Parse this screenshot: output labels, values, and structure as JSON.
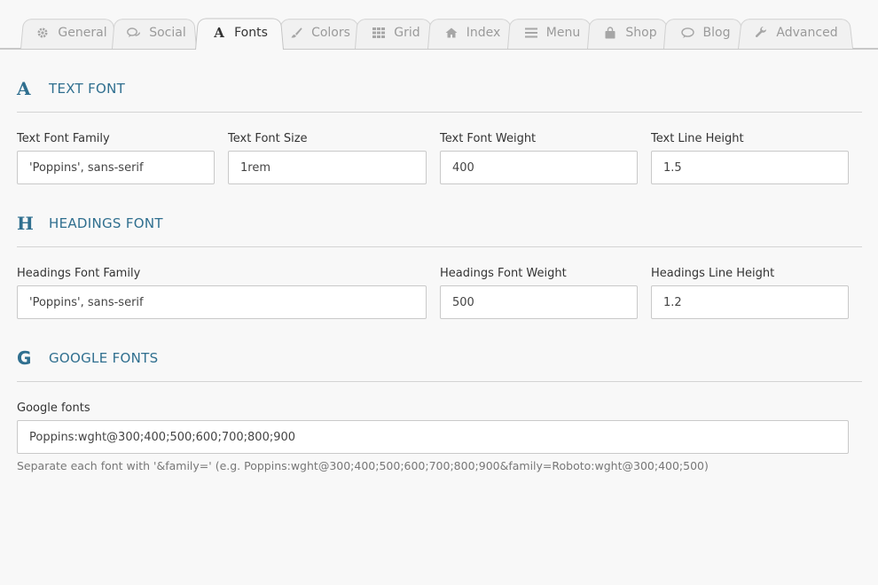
{
  "tabs": [
    {
      "label": "General",
      "icon": "gear-icon"
    },
    {
      "label": "Social",
      "icon": "comments-icon"
    },
    {
      "label": "Fonts",
      "icon": "font-icon",
      "active": true
    },
    {
      "label": "Colors",
      "icon": "brush-icon"
    },
    {
      "label": "Grid",
      "icon": "grid-icon"
    },
    {
      "label": "Index",
      "icon": "home-icon"
    },
    {
      "label": "Menu",
      "icon": "bars-icon"
    },
    {
      "label": "Shop",
      "icon": "shopping-bag-icon"
    },
    {
      "label": "Blog",
      "icon": "comment-icon"
    },
    {
      "label": "Advanced",
      "icon": "wrench-icon"
    }
  ],
  "text_font": {
    "letter": "A",
    "title": "TEXT FONT",
    "family_label": "Text Font Family",
    "family_value": "'Poppins', sans-serif",
    "size_label": "Text Font Size",
    "size_value": "1rem",
    "weight_label": "Text Font Weight",
    "weight_value": "400",
    "line_height_label": "Text Line Height",
    "line_height_value": "1.5"
  },
  "headings_font": {
    "letter": "H",
    "title": "HEADINGS FONT",
    "family_label": "Headings Font Family",
    "family_value": "'Poppins', sans-serif",
    "weight_label": "Headings Font Weight",
    "weight_value": "500",
    "line_height_label": "Headings Line Height",
    "line_height_value": "1.2"
  },
  "google_fonts": {
    "letter": "G",
    "title": "GOOGLE FONTS",
    "label": "Google fonts",
    "value": "Poppins:wght@300;400;500;600;700;800;900",
    "help": "Separate each font with '&family=' (e.g. Poppins:wght@300;400;500;600;700;800;900&family=Roboto:wght@300;400;500)"
  },
  "colors": {
    "accent": "#2f6f8f",
    "tab_inactive_text": "#9a9a9a"
  }
}
